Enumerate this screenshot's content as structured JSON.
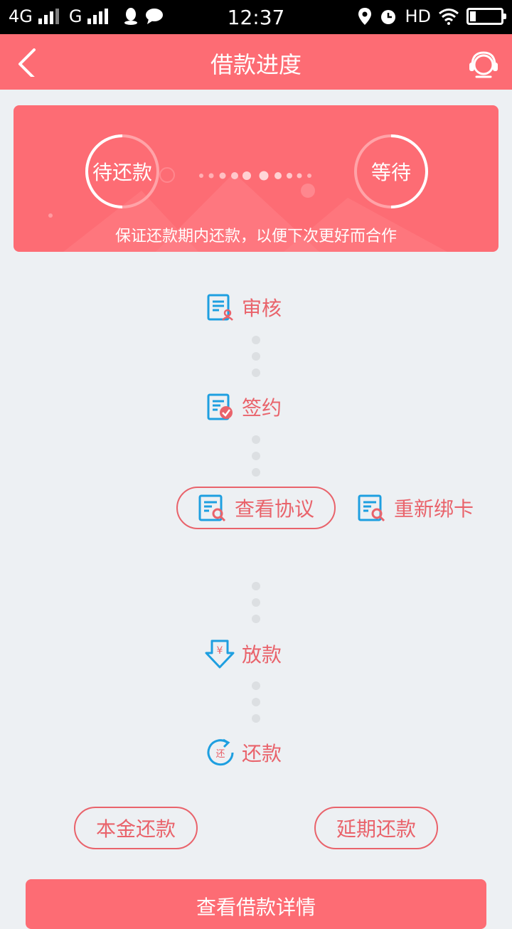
{
  "status_bar": {
    "network1": "4G",
    "network2": "G",
    "time": "12:37",
    "hd": "HD"
  },
  "header": {
    "title": "借款进度",
    "back_icon": "chevron-left-icon",
    "service_icon": "headset-icon"
  },
  "banner": {
    "left_status": "待还款",
    "right_status": "等待",
    "tip": "保证还款期内还款，以便下次更好而合作"
  },
  "steps": {
    "review": "审核",
    "sign": "签约",
    "view_agreement": "查看协议",
    "rebind_card": "重新绑卡",
    "disburse": "放款",
    "repay": "还款"
  },
  "actions": {
    "principal_repay": "本金还款",
    "extend_repay": "延期还款",
    "view_details": "查看借款详情"
  },
  "colors": {
    "brand": "#fd6c74",
    "accent_text": "#e9636b",
    "icon_blue": "#1e9fe0",
    "background": "#edf0f3"
  }
}
